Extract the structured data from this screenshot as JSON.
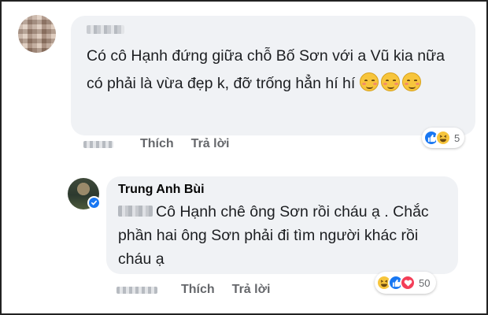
{
  "comment1": {
    "text": "Có cô Hạnh đứng giữa chỗ Bố Sơn với a Vũ kia nữa có phải là vừa đẹp k, đỡ trống hẳn hí hí",
    "emojis": [
      "smiling-face-with-blush-icon",
      "smiling-face-with-blush-icon",
      "smiling-face-with-blush-icon"
    ],
    "actions": {
      "like_label": "Thích",
      "reply_label": "Trả lời"
    },
    "reactions": {
      "icons": [
        "like-icon",
        "haha-icon"
      ],
      "count": "5"
    }
  },
  "comment2": {
    "author": "Trung Anh Bùi",
    "verified": true,
    "text": "Cô Hạnh chê ông Sơn rồi cháu ạ . Chắc phần hai ông Sơn phải đi tìm người khác rồi cháu ạ",
    "actions": {
      "like_label": "Thích",
      "reply_label": "Trả lời"
    },
    "reactions": {
      "icons": [
        "haha-icon",
        "like-icon",
        "love-icon"
      ],
      "count": "50"
    }
  },
  "colors": {
    "bubble": "#f0f2f5",
    "meta_text": "#65676b",
    "like_blue": "#1877f2",
    "love_red": "#f33e58",
    "haha_yellow": "#f7c53c"
  }
}
